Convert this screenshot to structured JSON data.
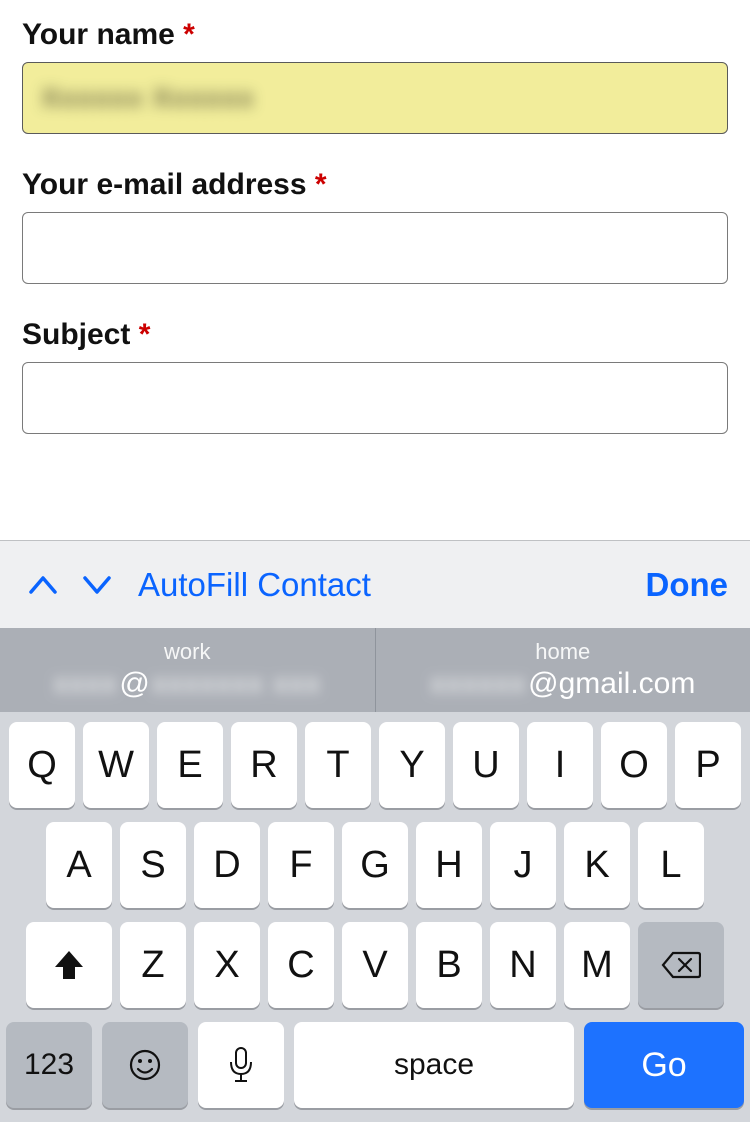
{
  "form": {
    "name": {
      "label": "Your name",
      "required": "*",
      "value": ""
    },
    "email": {
      "label": "Your e-mail address",
      "required": "*",
      "value": ""
    },
    "subject": {
      "label": "Subject",
      "required": "*",
      "value": ""
    }
  },
  "accessory": {
    "autofill": "AutoFill Contact",
    "done": "Done"
  },
  "suggestions": {
    "left": {
      "tag": "work",
      "at": "@"
    },
    "right": {
      "tag": "home",
      "domain": "@gmail.com"
    }
  },
  "keys": {
    "row1": [
      "Q",
      "W",
      "E",
      "R",
      "T",
      "Y",
      "U",
      "I",
      "O",
      "P"
    ],
    "row2": [
      "A",
      "S",
      "D",
      "F",
      "G",
      "H",
      "J",
      "K",
      "L"
    ],
    "row3": [
      "Z",
      "X",
      "C",
      "V",
      "B",
      "N",
      "M"
    ],
    "num": "123",
    "space": "space",
    "go": "Go"
  }
}
